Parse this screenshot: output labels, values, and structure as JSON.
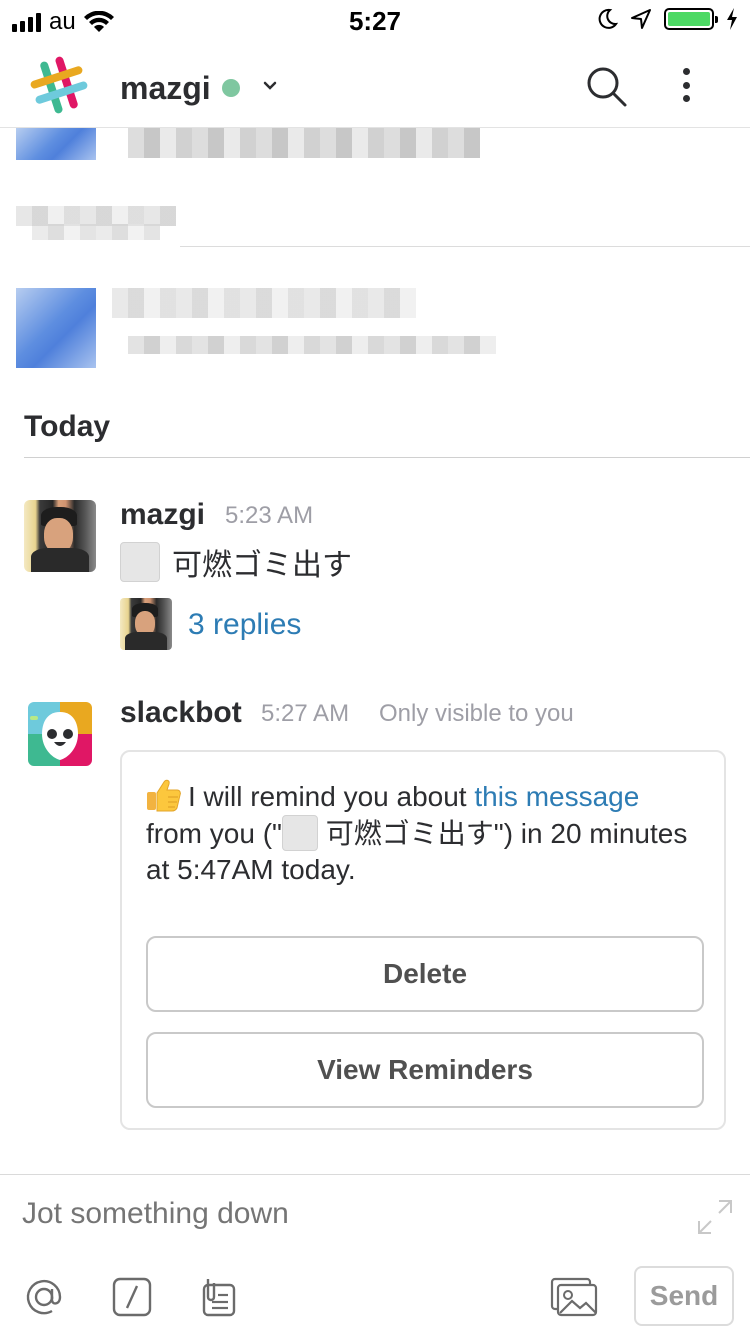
{
  "status_bar": {
    "carrier": "au",
    "time": "5:27"
  },
  "header": {
    "team_name": "mazgi",
    "presence": "online",
    "icons": [
      "slack-logo-icon",
      "chevron-down-icon",
      "search-icon",
      "more-vertical-icon"
    ]
  },
  "divider": {
    "label": "Today"
  },
  "messages": [
    {
      "sender": "mazgi",
      "time": "5:23 AM",
      "text": "可燃ゴミ出す",
      "replies": "3 replies"
    },
    {
      "sender": "slackbot",
      "time": "5:27 AM",
      "visibility": "Only visible to you",
      "attachment": {
        "text_before_link": "I will remind you about ",
        "link_text": "this message",
        "text_after_link_1": "from you (\"",
        "quoted_text": " 可燃ゴミ出す",
        "text_after_link_2": "\") in 20 minutes at 5:47AM today.",
        "buttons": [
          "Delete",
          "View Reminders"
        ]
      }
    }
  ],
  "composer": {
    "placeholder": "Jot something down",
    "send_label": "Send",
    "tools": [
      "mention-icon",
      "slash-command-icon",
      "snippet-icon",
      "photo-icon"
    ]
  },
  "colors": {
    "link": "#2d7cb4",
    "presence": "#7fc7a0",
    "battery": "#4cd964"
  }
}
